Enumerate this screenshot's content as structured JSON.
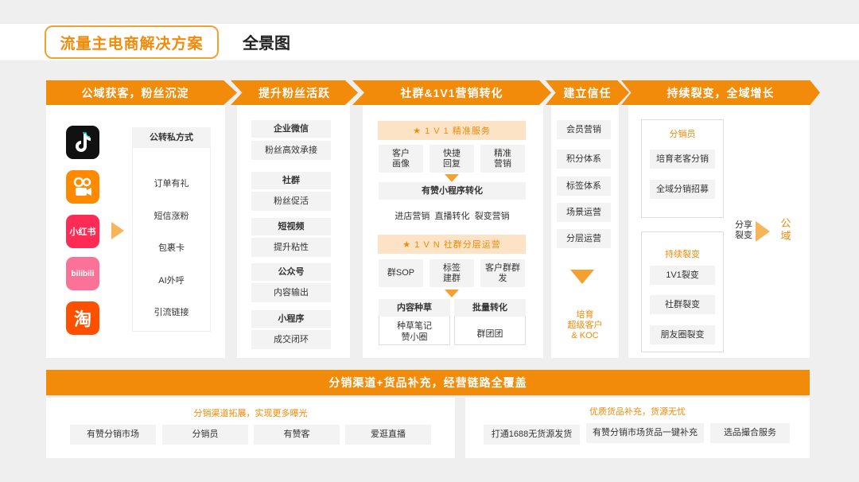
{
  "header": {
    "title": "流量主电商解决方案",
    "subtitle": "全景图"
  },
  "stages": [
    {
      "label": "公域获客，粉丝沉淀"
    },
    {
      "label": "提升粉丝活跃"
    },
    {
      "label": "社群&1V1营销转化"
    },
    {
      "label": "建立信任"
    },
    {
      "label": "持续裂变，全域增长"
    }
  ],
  "col1": {
    "apps": [
      {
        "name": "tiktok-icon",
        "label": ""
      },
      {
        "name": "kuaishou-icon",
        "label": ""
      },
      {
        "name": "xiaohongshu-icon",
        "label": "小红书"
      },
      {
        "name": "bilibili-icon",
        "label": "bilibili"
      },
      {
        "name": "taobao-icon",
        "label": "淘"
      }
    ],
    "list_title": "公转私方式",
    "items": [
      "订单有礼",
      "短信涨粉",
      "包裹卡",
      "AI外呼",
      "引流链接"
    ]
  },
  "col2": {
    "groups": [
      {
        "title": "企业微信",
        "desc": "粉丝高效承接"
      },
      {
        "title": "社群",
        "desc": "粉丝促活"
      },
      {
        "title": "短视频",
        "desc": "提升粘性"
      },
      {
        "title": "公众号",
        "desc": "内容输出"
      },
      {
        "title": "小程序",
        "desc": "成交闭环"
      }
    ]
  },
  "col3": {
    "bar1": "★ 1 V 1 精准服务",
    "chips1": [
      "客户\n画像",
      "快捷\n回复",
      "精准\n营销"
    ],
    "mini_title": "有赞小程序转化",
    "mini_items": "进店营销  直播转化  裂变营销",
    "bar2": "★ 1 V N 社群分层运营",
    "chips2": [
      "群SOP",
      "标签\n建群",
      "客户群群\n发"
    ],
    "content_title": "内容种草",
    "content_desc": "种草笔记\n赞小圈",
    "batch_title": "批量转化",
    "batch_desc": "群团团"
  },
  "col4": {
    "items": [
      "会员营销",
      "积分体系",
      "标签体系",
      "场景运营",
      "分层运营"
    ],
    "result": "培育\n超级客户\n& KOC"
  },
  "col5": {
    "dist_title": "分销员",
    "dist_items": [
      "培育老客分销",
      "全域分销招募"
    ],
    "fission_title": "持续裂变",
    "fission_items": [
      "1V1裂变",
      "社群裂变",
      "朋友圈裂变"
    ],
    "share_label": "分享\n裂变",
    "public_label": "公\n域"
  },
  "bottom": {
    "title": "分销渠道+货品补充，经营链路全覆盖",
    "left_title": "分销渠道拓展，实现更多曝光",
    "left_items": [
      "有赞分销市场",
      "分销员",
      "有赞客",
      "爱逛直播"
    ],
    "right_title": "优质货品补充，货源无忧",
    "right_items": [
      "打通1688无货源发货",
      "有赞分销市场货品一键补充",
      "选品撮合服务"
    ]
  },
  "colors": {
    "accent": "#f28a0a",
    "light_accent": "#fde3c5",
    "panel": "#ffffff",
    "chip": "#f3f3f3"
  }
}
